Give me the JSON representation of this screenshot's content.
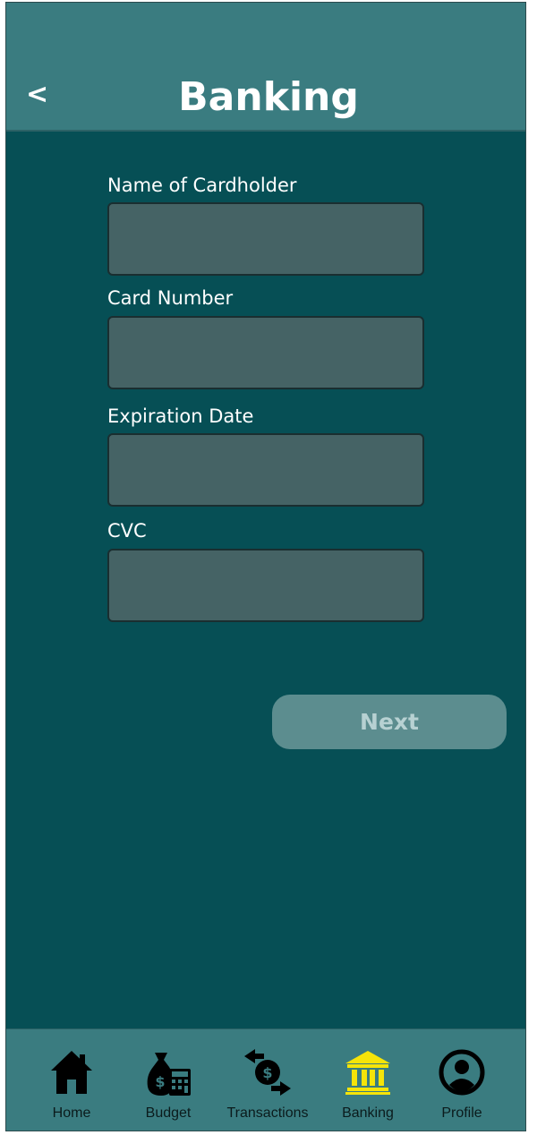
{
  "header": {
    "back_label": "<",
    "title": "Banking"
  },
  "form": {
    "fields": [
      {
        "label": "Name of Cardholder",
        "value": ""
      },
      {
        "label": "Card Number",
        "value": ""
      },
      {
        "label": "Expiration Date",
        "value": ""
      },
      {
        "label": "CVC",
        "value": ""
      }
    ],
    "next_label": "Next"
  },
  "nav": {
    "items": [
      {
        "label": "Home",
        "icon": "home-icon"
      },
      {
        "label": "Budget",
        "icon": "money-bag-calculator-icon"
      },
      {
        "label": "Transactions",
        "icon": "transfer-icon"
      },
      {
        "label": "Banking",
        "icon": "bank-icon",
        "active": true
      },
      {
        "label": "Profile",
        "icon": "profile-icon"
      }
    ],
    "active_color": "#f5e409",
    "icon_color": "#000000"
  },
  "colors": {
    "background": "#064f55",
    "header": "#3a7c80",
    "input": "#456365",
    "button": "#5c8d8f"
  }
}
